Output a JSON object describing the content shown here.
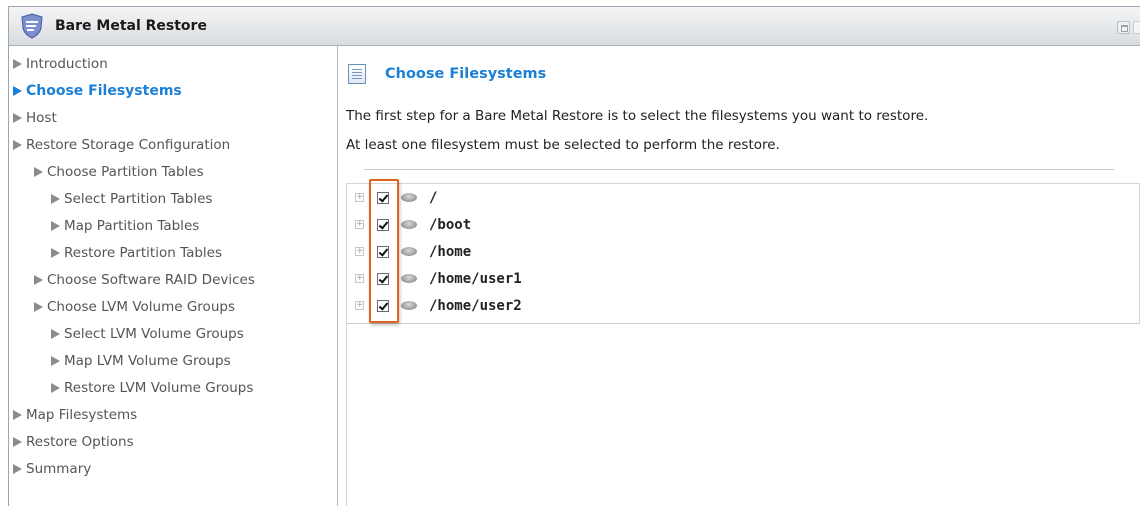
{
  "window": {
    "title": "Bare Metal Restore"
  },
  "sidebar": {
    "items": [
      {
        "label": "Introduction",
        "level": 0,
        "active": false
      },
      {
        "label": "Choose Filesystems",
        "level": 0,
        "active": true
      },
      {
        "label": "Host",
        "level": 0,
        "active": false
      },
      {
        "label": "Restore Storage Configuration",
        "level": 0,
        "active": false
      },
      {
        "label": "Choose Partition Tables",
        "level": 1,
        "active": false
      },
      {
        "label": "Select Partition Tables",
        "level": 2,
        "active": false
      },
      {
        "label": "Map Partition Tables",
        "level": 2,
        "active": false
      },
      {
        "label": "Restore Partition Tables",
        "level": 2,
        "active": false
      },
      {
        "label": "Choose Software RAID Devices",
        "level": 1,
        "active": false
      },
      {
        "label": "Choose LVM Volume Groups",
        "level": 1,
        "active": false
      },
      {
        "label": "Select LVM Volume Groups",
        "level": 2,
        "active": false
      },
      {
        "label": "Map LVM Volume Groups",
        "level": 2,
        "active": false
      },
      {
        "label": "Restore LVM Volume Groups",
        "level": 2,
        "active": false
      },
      {
        "label": "Map Filesystems",
        "level": 0,
        "active": false
      },
      {
        "label": "Restore Options",
        "level": 0,
        "active": false
      },
      {
        "label": "Summary",
        "level": 0,
        "active": false
      }
    ]
  },
  "main": {
    "title": "Choose Filesystems",
    "description_1": "The first step for a Bare Metal Restore is to select the filesystems you want to restore.",
    "description_2": "At least one filesystem must be selected to perform the restore.",
    "filesystems": [
      {
        "path": "/",
        "checked": true
      },
      {
        "path": "/boot",
        "checked": true
      },
      {
        "path": "/home",
        "checked": true
      },
      {
        "path": "/home/user1",
        "checked": true
      },
      {
        "path": "/home/user2",
        "checked": true
      }
    ]
  },
  "colors": {
    "accent": "#1b7fd6",
    "highlight_box": "#e0621f"
  }
}
